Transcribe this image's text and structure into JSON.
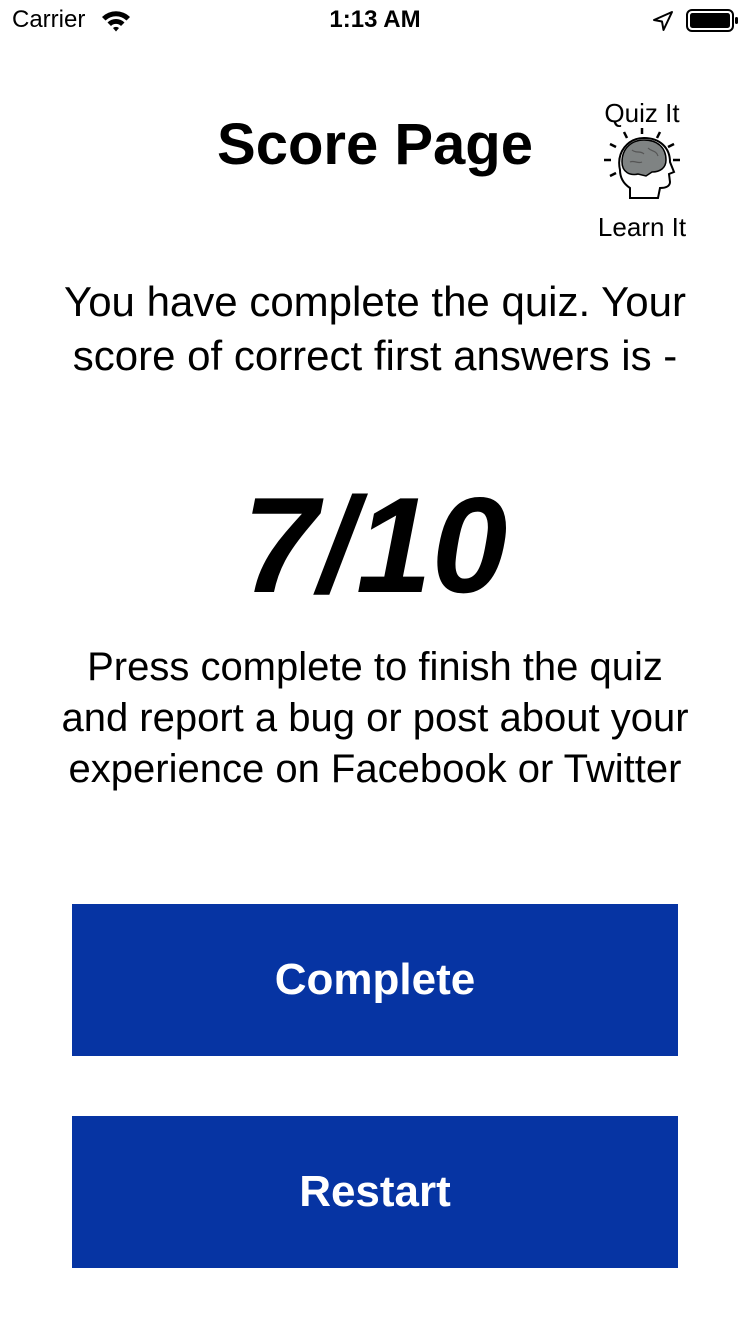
{
  "status_bar": {
    "carrier": "Carrier",
    "time": "1:13 AM",
    "icons": [
      "wifi-icon",
      "location-arrow-icon",
      "battery-icon"
    ]
  },
  "header": {
    "title": "Score Page"
  },
  "logo": {
    "top_text": "Quiz It",
    "bottom_text": "Learn It",
    "icon": "brain-head-icon"
  },
  "main": {
    "intro_text": "You have complete the quiz. Your score of correct first answers is -",
    "score": "7/10",
    "info_text": "Press complete to finish the quiz and report a bug or post about your experience on Facebook or Twitter"
  },
  "buttons": {
    "complete_label": "Complete",
    "restart_label": "Restart"
  },
  "colors": {
    "button_background": "#0634a3",
    "button_text": "#ffffff",
    "background": "#ffffff",
    "text": "#000000"
  }
}
